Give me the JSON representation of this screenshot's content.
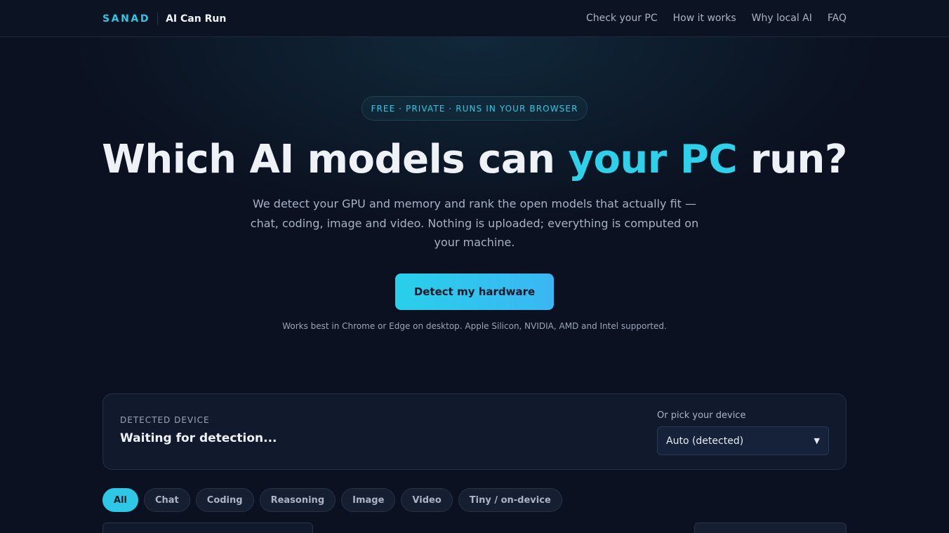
{
  "header": {
    "logo": "SANAD",
    "app_name": "AI Can Run",
    "nav": [
      "Check your PC",
      "How it works",
      "Why local AI",
      "FAQ"
    ]
  },
  "hero": {
    "badge": "FREE · PRIVATE · RUNS IN YOUR BROWSER",
    "title_before": "Which AI models can ",
    "title_accent": "your PC",
    "title_after": " run?",
    "subtitle": "We detect your GPU and memory and rank the open models that actually fit — chat, coding, image and video. Nothing is uploaded; everything is computed on your machine.",
    "cta_label": "Detect my hardware",
    "hint": "Works best in Chrome or Edge on desktop. Apple Silicon, NVIDIA, AMD and Intel supported."
  },
  "device": {
    "label": "DETECTED DEVICE",
    "value": "Waiting for detection...",
    "pick_label": "Or pick your device",
    "selected": "Auto (detected)"
  },
  "filters": {
    "active": "All",
    "items": [
      "All",
      "Chat",
      "Coding",
      "Reasoning",
      "Image",
      "Video",
      "Tiny / on-device"
    ]
  },
  "colors": {
    "accent": "#2ec8e6",
    "background": "#0b1120",
    "card": "#111a2c"
  }
}
